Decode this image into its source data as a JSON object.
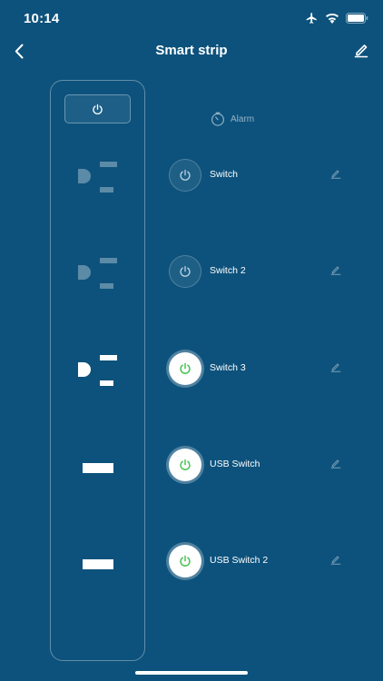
{
  "status_bar": {
    "time": "10:14",
    "icons": [
      "airplane-icon",
      "wifi-icon",
      "battery-icon"
    ]
  },
  "header": {
    "title": "Smart strip",
    "back_icon": "chevron-left-icon",
    "edit_icon": "pencil-icon"
  },
  "alarm": {
    "label": "Alarm",
    "icon": "timer-icon"
  },
  "strip": {
    "master_icon": "power-icon",
    "sockets": [
      {
        "type": "ac",
        "state": "off"
      },
      {
        "type": "ac",
        "state": "off"
      },
      {
        "type": "ac",
        "state": "on"
      },
      {
        "type": "usb",
        "state": "on"
      },
      {
        "type": "usb",
        "state": "on"
      }
    ]
  },
  "switches": [
    {
      "label": "Switch",
      "state": "off"
    },
    {
      "label": "Switch 2",
      "state": "off"
    },
    {
      "label": "Switch 3",
      "state": "on"
    },
    {
      "label": "USB Switch",
      "state": "on"
    },
    {
      "label": "USB Switch 2",
      "state": "on"
    }
  ],
  "colors": {
    "background": "#0d527c",
    "power_on": "#3cc04a",
    "power_off": "#bcd3e3",
    "socket_off": "rgba(255,255,255,0.35)",
    "socket_on": "#ffffff"
  }
}
